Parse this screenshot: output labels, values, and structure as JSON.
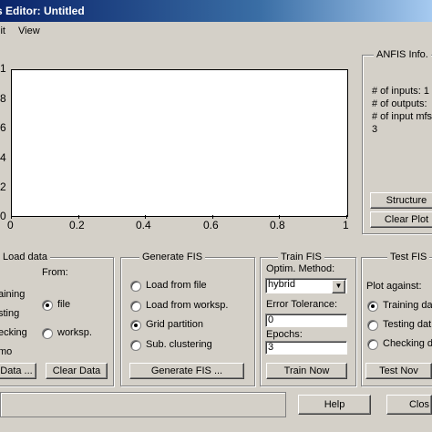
{
  "window": {
    "title": "s Editor: Untitled"
  },
  "menu": [
    "lit",
    "View"
  ],
  "plot": {
    "y_ticks": [
      "1",
      "8",
      "6",
      "4",
      "2",
      "0"
    ],
    "x_ticks": [
      "0",
      "0.2",
      "0.4",
      "0.6",
      "0.8",
      "1"
    ]
  },
  "anfis_info": {
    "title": "ANFIS Info.",
    "lines": [
      "# of inputs: 1",
      "# of outputs:",
      "# of input mfs",
      "3"
    ],
    "structure_button": "Structure",
    "clear_plot_button": "Clear Plot"
  },
  "load_data": {
    "title": "Load data",
    "from_label": "From:",
    "type_options": [
      "aining",
      "sting",
      "ecking",
      "mo"
    ],
    "from_options": [
      "file",
      "worksp."
    ],
    "from_selected": "file",
    "load_button": "Data ...",
    "clear_button": "Clear Data"
  },
  "generate_fis": {
    "title": "Generate FIS",
    "options": [
      "Load from file",
      "Load from worksp.",
      "Grid partition",
      "Sub. clustering"
    ],
    "selected": "Grid partition",
    "button": "Generate FIS ..."
  },
  "train_fis": {
    "title": "Train FIS",
    "optim_label": "Optim. Method:",
    "optim_value": "hybrid",
    "error_label": "Error Tolerance:",
    "error_value": "0",
    "epochs_label": "Epochs:",
    "epochs_value": "3",
    "button": "Train Now"
  },
  "test_fis": {
    "title": "Test FIS",
    "plot_against": "Plot against:",
    "options": [
      "Training da",
      "Testing dat",
      "Checking d"
    ],
    "selected": "Training da",
    "button": "Test Nov"
  },
  "footer": {
    "help": "Help",
    "close": "Clos"
  }
}
